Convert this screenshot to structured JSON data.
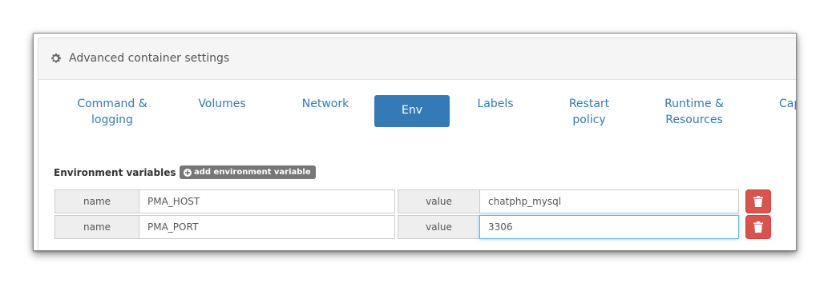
{
  "panel": {
    "title": "Advanced container settings",
    "icon": "gear-icon"
  },
  "tabs": [
    {
      "label": "Command &\nlogging",
      "active": false
    },
    {
      "label": "Volumes",
      "active": false
    },
    {
      "label": "Network",
      "active": false
    },
    {
      "label": "Env",
      "active": true
    },
    {
      "label": "Labels",
      "active": false
    },
    {
      "label": "Restart\npolicy",
      "active": false
    },
    {
      "label": "Runtime &\nResources",
      "active": false
    },
    {
      "label": "Cap",
      "active": false
    }
  ],
  "env": {
    "section_label": "Environment variables",
    "add_button_label": "add environment variable",
    "name_addon": "name",
    "value_addon": "value",
    "variables": [
      {
        "name": "PMA_HOST",
        "value": "chatphp_mysql"
      },
      {
        "name": "PMA_PORT",
        "value": "3306"
      }
    ]
  },
  "colors": {
    "primary": "#337ab7",
    "danger": "#d9534f",
    "badge": "#777777"
  }
}
